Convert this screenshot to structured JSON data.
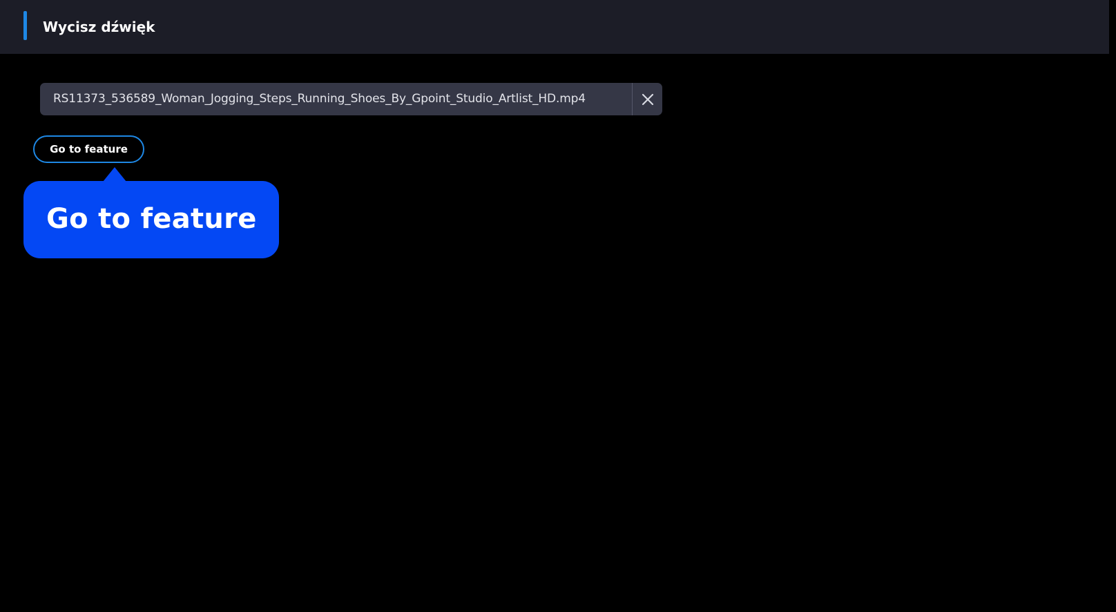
{
  "header": {
    "title": "Wycisz dźwięk",
    "accent_color": "#1e88e5"
  },
  "file": {
    "name": "RS11373_536589_Woman_Jogging_Steps_Running_Shoes_By_Gpoint_Studio_Artlist_HD.mp4",
    "close_icon": "close-icon"
  },
  "feature_button": {
    "label": "Go to feature",
    "border_color": "#1e88e5"
  },
  "tooltip": {
    "text": "Go to feature",
    "background_color": "#0448f4"
  },
  "colors": {
    "background": "#000000",
    "header_background": "#1c1d27",
    "chip_background": "#353746"
  }
}
